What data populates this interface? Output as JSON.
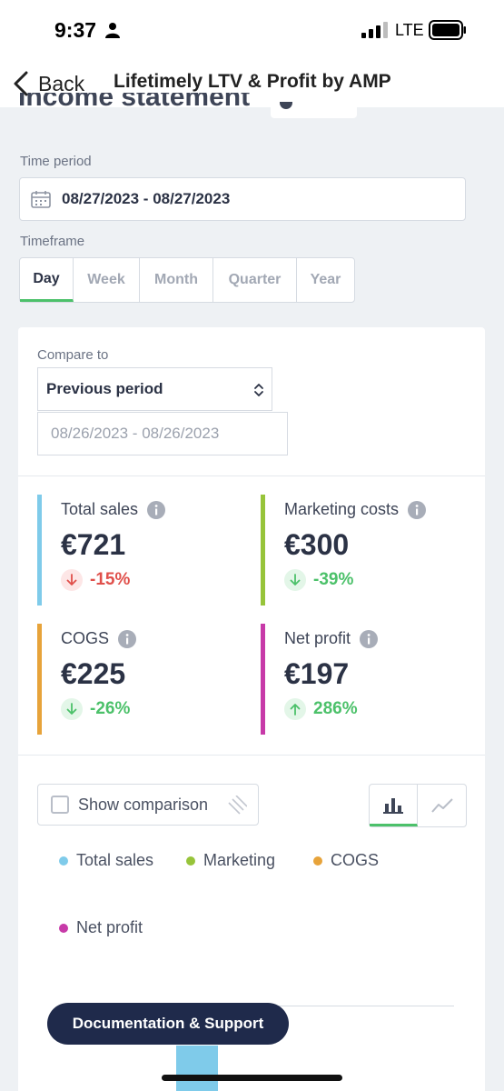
{
  "status_bar": {
    "time": "9:37",
    "network": "LTE"
  },
  "nav": {
    "back_label": "Back",
    "title": "Lifetimely LTV & Profit by AMP"
  },
  "page": {
    "heading": "Income statement"
  },
  "time_period": {
    "label": "Time period",
    "value": "08/27/2023 - 08/27/2023"
  },
  "timeframe": {
    "label": "Timeframe",
    "tabs": [
      "Day",
      "Week",
      "Month",
      "Quarter",
      "Year"
    ],
    "active": "Day"
  },
  "compare": {
    "label": "Compare to",
    "selected": "Previous period",
    "range": "08/26/2023 - 08/26/2023"
  },
  "metrics": [
    {
      "label": "Total sales",
      "value": "€721",
      "change": "-15%",
      "direction": "down",
      "trend": "negative",
      "color": "#7fcbea"
    },
    {
      "label": "Marketing costs",
      "value": "€300",
      "change": "-39%",
      "direction": "down",
      "trend": "positive",
      "color": "#97c43a"
    },
    {
      "label": "COGS",
      "value": "€225",
      "change": "-26%",
      "direction": "down",
      "trend": "positive",
      "color": "#e7a33a"
    },
    {
      "label": "Net profit",
      "value": "€197",
      "change": "286%",
      "direction": "up",
      "trend": "positive",
      "color": "#c73aa8"
    }
  ],
  "chart_controls": {
    "show_comparison_label": "Show comparison",
    "show_comparison_checked": false,
    "active_view": "bar"
  },
  "legend": [
    {
      "label": "Total sales",
      "color": "#7fcbea"
    },
    {
      "label": "Marketing",
      "color": "#97c43a"
    },
    {
      "label": "COGS",
      "color": "#e7a33a"
    },
    {
      "label": "Net profit",
      "color": "#c73aa8"
    }
  ],
  "colors": {
    "negative": "#e0504b",
    "positive": "#4cc16a",
    "negative_bg": "#fde6e6",
    "positive_bg": "#e3f6e8"
  },
  "support_button": {
    "label": "Documentation & Support"
  }
}
